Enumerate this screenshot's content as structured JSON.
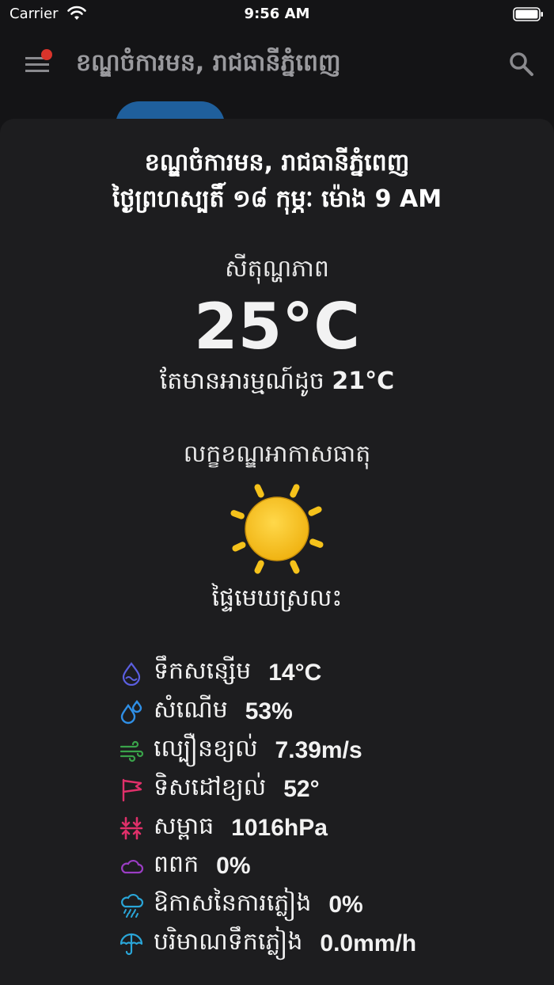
{
  "status_bar": {
    "carrier": "Carrier",
    "time": "9:56 AM"
  },
  "app_bar": {
    "title": "ខណ្ឌចំការមន, រាជធានីភ្នំពេញ"
  },
  "sheet": {
    "location": "ខណ្ឌចំការមន, រាជធានីភ្នំពេញ",
    "date": "ថ្ងៃព្រហស្បតិ៍ ១៨ កុម្ភៈ ម៉ោង 9 AM",
    "temperature_label": "សីតុណ្ហភាព",
    "temperature": "25°C",
    "feels_like_label": "តែមានអារម្មណ៍ដូច",
    "feels_like": "21°C",
    "condition_label": "លក្ខខណ្ឌអាកាសធាតុ",
    "condition_icon": "sun-icon",
    "condition": "ផ្ទៃមេឃស្រលះ",
    "details": [
      {
        "icon": "dew-point-icon",
        "label": "ទឹកសន្សើម",
        "value": "14°C",
        "color": "#5b5fe0"
      },
      {
        "icon": "humidity-icon",
        "label": "សំណើម",
        "value": "53%",
        "color": "#2f8fe6"
      },
      {
        "icon": "wind-speed-icon",
        "label": "ល្បឿនខ្យល់",
        "value": "7.39m/s",
        "color": "#3aa34a"
      },
      {
        "icon": "wind-direction-icon",
        "label": "ទិសដៅខ្យល់",
        "value": "52°",
        "color": "#e0306a"
      },
      {
        "icon": "pressure-icon",
        "label": "សម្ពាធ",
        "value": "1016hPa",
        "color": "#e0306a"
      },
      {
        "icon": "cloud-icon",
        "label": "ពពក",
        "value": "0%",
        "color": "#9b3dc4"
      },
      {
        "icon": "rain-chance-icon",
        "label": "ឱកាសនៃការភ្លៀង",
        "value": "0%",
        "color": "#2aa6d8"
      },
      {
        "icon": "umbrella-icon",
        "label": "បរិមាណទឹកភ្លៀង",
        "value": "0.0mm/h",
        "color": "#2aa6d8"
      }
    ]
  },
  "colors": {
    "sun": "#f5c21b",
    "sheet_bg": "#1d1d1f",
    "page_bg": "#141416"
  }
}
